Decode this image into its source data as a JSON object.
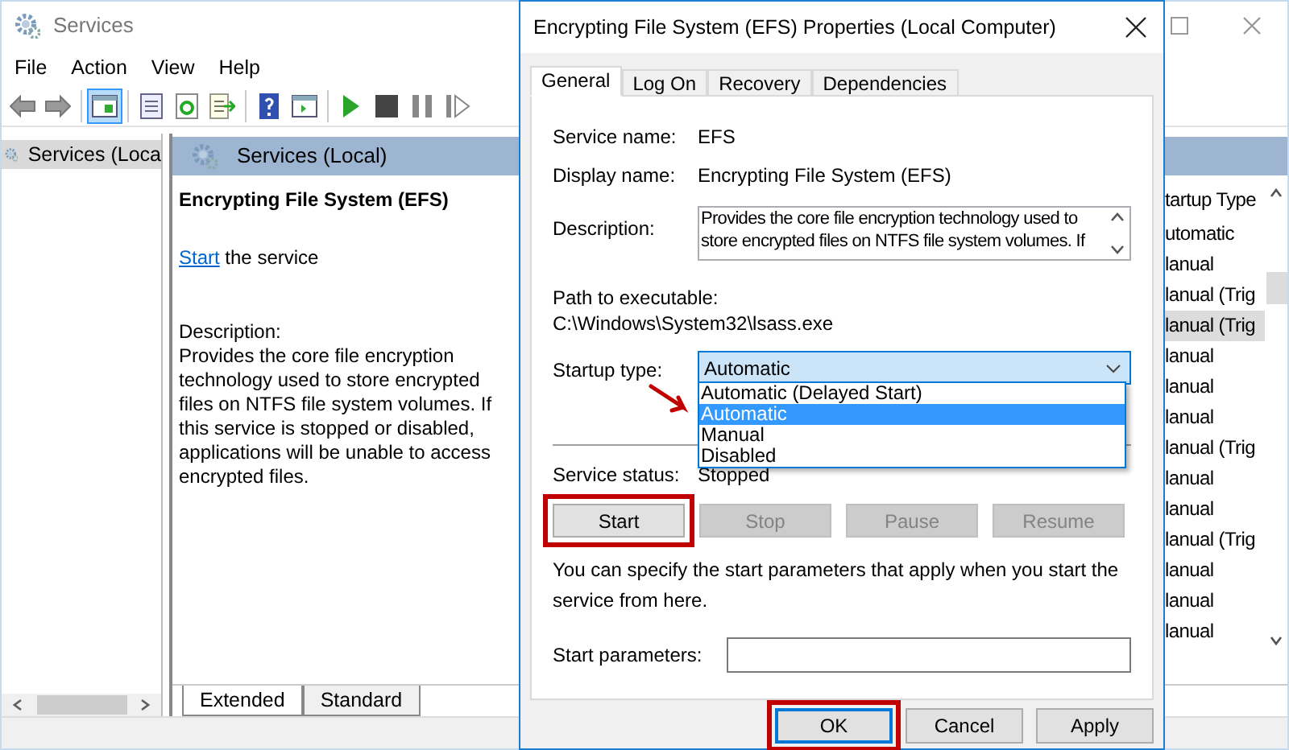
{
  "main_window": {
    "title": "Services",
    "menu": [
      "File",
      "Action",
      "View",
      "Help"
    ],
    "toolbar": [
      [
        {
          "kind": "back",
          "pressed": false
        },
        {
          "kind": "forward",
          "pressed": false
        }
      ],
      [
        {
          "kind": "tree",
          "pressed": true
        }
      ],
      [
        {
          "kind": "props",
          "pressed": false
        },
        {
          "kind": "refresh",
          "pressed": false
        },
        {
          "kind": "export",
          "pressed": false
        }
      ],
      [
        {
          "kind": "help",
          "pressed": false
        },
        {
          "kind": "pane",
          "pressed": false
        }
      ],
      [
        {
          "kind": "play",
          "pressed": false
        },
        {
          "kind": "stop",
          "pressed": false
        },
        {
          "kind": "pause",
          "pressed": false
        },
        {
          "kind": "resume",
          "pressed": false
        }
      ]
    ],
    "tree": [
      {
        "label": "Services (Loca",
        "selected": true
      }
    ],
    "pane_header": "Services (Local)",
    "service_title": "Encrypting File System (EFS)",
    "action_link": "Start",
    "action_text": "the service",
    "description_label": "Description:",
    "description": "Provides the core file encryption technology used to store encrypted files on NTFS file system volumes. If this service is stopped or disabled, applications will be unable to access encrypted files.",
    "view_tabs": [
      {
        "label": "Extended",
        "selected": true
      },
      {
        "label": "Standard",
        "selected": false
      }
    ],
    "list": {
      "column_header": "tartup Type",
      "rows": [
        {
          "cell": "utomatic",
          "selected": false
        },
        {
          "cell": "lanual",
          "selected": false
        },
        {
          "cell": "lanual (Trig",
          "selected": false
        },
        {
          "cell": "lanual (Trig",
          "selected": true
        },
        {
          "cell": "lanual",
          "selected": false
        },
        {
          "cell": "lanual",
          "selected": false
        },
        {
          "cell": "lanual",
          "selected": false
        },
        {
          "cell": "lanual (Trig",
          "selected": false
        },
        {
          "cell": "lanual",
          "selected": false
        },
        {
          "cell": "lanual",
          "selected": false
        },
        {
          "cell": "lanual (Trig",
          "selected": false
        },
        {
          "cell": "lanual",
          "selected": false
        },
        {
          "cell": "lanual",
          "selected": false
        },
        {
          "cell": "lanual",
          "selected": false
        }
      ]
    }
  },
  "dialog": {
    "title": "Encrypting File System (EFS) Properties (Local Computer)",
    "tabs": [
      {
        "label": "General",
        "selected": true
      },
      {
        "label": "Log On",
        "selected": false
      },
      {
        "label": "Recovery",
        "selected": false
      },
      {
        "label": "Dependencies",
        "selected": false
      }
    ],
    "service_name_label": "Service name:",
    "service_name": "EFS",
    "display_name_label": "Display name:",
    "display_name": "Encrypting File System (EFS)",
    "description_label": "Description:",
    "description": "Provides the core file encryption technology used to store encrypted files on NTFS file system volumes. If",
    "path_label": "Path to executable:",
    "path": "C:\\Windows\\System32\\lsass.exe",
    "startup_type_label": "Startup type:",
    "startup_type": {
      "value": "Automatic",
      "expanded": true,
      "options": [
        {
          "label": "Automatic (Delayed Start)",
          "selected": false
        },
        {
          "label": "Automatic",
          "selected": true
        },
        {
          "label": "Manual",
          "selected": false
        },
        {
          "label": "Disabled",
          "selected": false
        }
      ]
    },
    "status_label": "Service status:",
    "status": "Stopped",
    "control_buttons": [
      {
        "label": "Start",
        "disabled": false,
        "highlighted": true
      },
      {
        "label": "Stop",
        "disabled": true,
        "highlighted": false
      },
      {
        "label": "Pause",
        "disabled": true,
        "highlighted": false
      },
      {
        "label": "Resume",
        "disabled": true,
        "highlighted": false
      }
    ],
    "params_note": "You can specify the start parameters that apply when you start the service from here.",
    "params_label": "Start parameters:",
    "buttons": [
      {
        "label": "OK",
        "default": true,
        "highlighted": true
      },
      {
        "label": "Cancel",
        "default": false,
        "highlighted": false
      },
      {
        "label": "Apply",
        "default": false,
        "highlighted": false
      }
    ]
  }
}
